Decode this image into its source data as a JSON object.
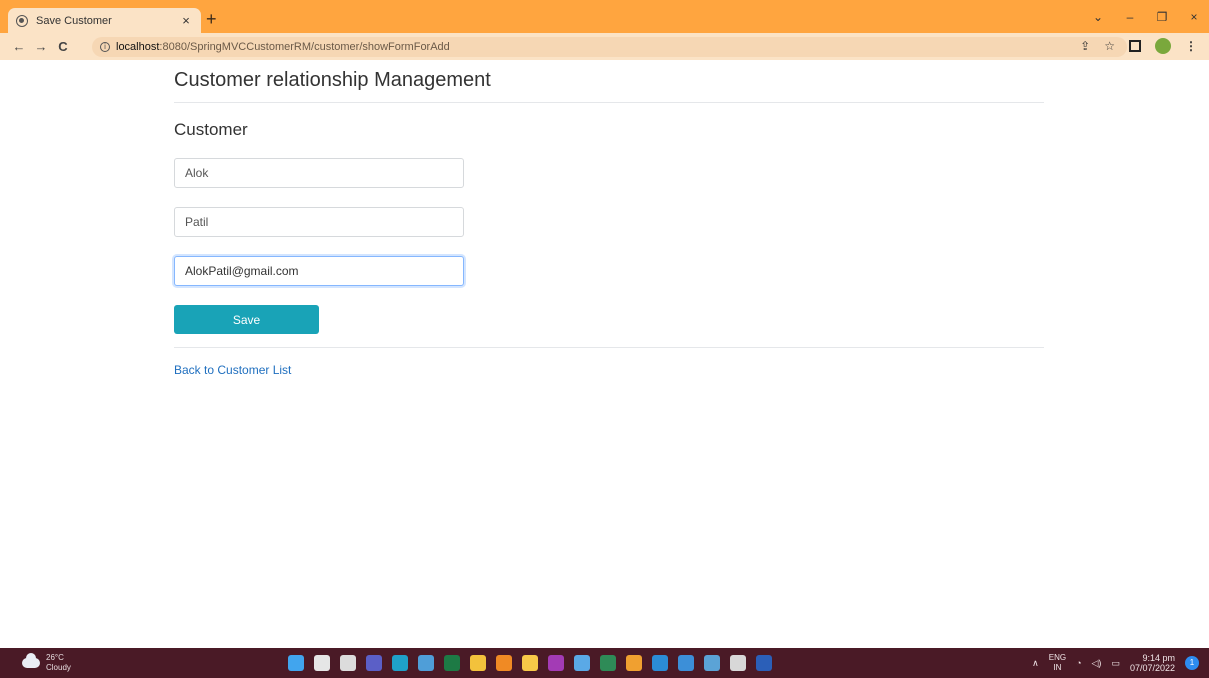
{
  "browser": {
    "tab_title": "Save Customer",
    "tab_close": "×",
    "new_tab": "+",
    "url_host": "localhost",
    "url_path": ":8080/SpringMVCCustomerRM/customer/showFormForAdd",
    "window_controls": {
      "minimize": "–",
      "restore": "❐",
      "close": "×",
      "dropdown": "⌄"
    },
    "nav": {
      "back": "←",
      "forward": "→",
      "reload": "C"
    }
  },
  "page": {
    "title": "Customer relationship Management",
    "form_heading": "Customer",
    "fields": {
      "first_name": "Alok",
      "last_name": "Patil",
      "email": "AlokPatil@gmail.com"
    },
    "save_label": "Save",
    "back_link": "Back to Customer List"
  },
  "taskbar": {
    "temperature": "26°C",
    "condition": "Cloudy",
    "lang_top": "ENG",
    "lang_bottom": "IN",
    "time": "9:14 pm",
    "date": "07/07/2022",
    "notifications": "1",
    "app_icons": [
      "start-icon",
      "search-icon",
      "task-view-icon",
      "teams-chat-icon",
      "edge-icon",
      "photos-icon",
      "excel-icon",
      "file-explorer-icon",
      "chrome-icon",
      "store-icon",
      "media-icon",
      "notepad-icon",
      "excel-2-icon",
      "eclipse-icon",
      "skype-icon",
      "terminal-icon",
      "remote-desktop-icon",
      "settings-icon",
      "word-icon"
    ],
    "app_colors": [
      "#41a5ee",
      "#e6e6e6",
      "#dcdcdc",
      "#5b5fc7",
      "#1fa1c9",
      "#4f9ed8",
      "#1d7a45",
      "#f3c23c",
      "#f08a24",
      "#f7c948",
      "#a33bb5",
      "#5aa9e6",
      "#2e8b57",
      "#f0a030",
      "#2b8cd6",
      "#3c8fd8",
      "#5ba3d6",
      "#d8d8d8",
      "#2b5fb8"
    ]
  }
}
